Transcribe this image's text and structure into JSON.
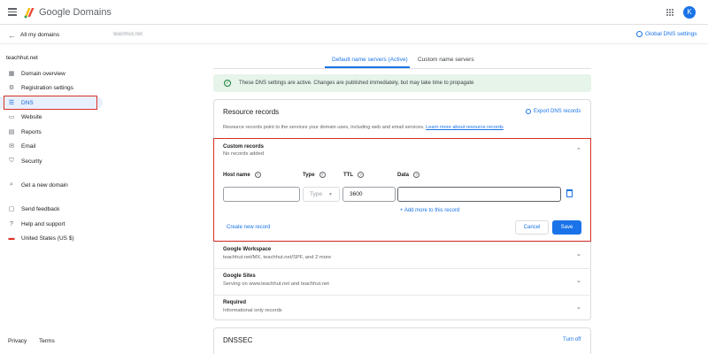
{
  "topbar": {
    "brand": "Google Domains",
    "avatar_letter": "K"
  },
  "subheader": {
    "back_label": "All my domains",
    "domain_crumb": "teachhut.net",
    "global_dns_label": "Global DNS settings"
  },
  "sidebar": {
    "site_name": "teachhut.net",
    "items": [
      {
        "label": "Domain overview",
        "icon": "domain-overview-icon",
        "glyph": "▦"
      },
      {
        "label": "Registration settings",
        "icon": "settings-icon",
        "glyph": "⚙"
      },
      {
        "label": "DNS",
        "icon": "dns-icon",
        "glyph": "☰"
      },
      {
        "label": "Website",
        "icon": "website-icon",
        "glyph": "▭"
      },
      {
        "label": "Reports",
        "icon": "reports-icon",
        "glyph": "▤"
      },
      {
        "label": "Email",
        "icon": "email-icon",
        "glyph": "✉"
      },
      {
        "label": "Security",
        "icon": "security-icon",
        "glyph": "⛉"
      },
      {
        "label": "Get a new domain",
        "icon": "search-icon",
        "glyph": "⌕"
      },
      {
        "label": "Send feedback",
        "icon": "feedback-icon",
        "glyph": "▢"
      },
      {
        "label": "Help and support",
        "icon": "help-icon",
        "glyph": "?"
      },
      {
        "label": "United States (US $)",
        "icon": "us-flag-icon",
        "glyph": "▬"
      }
    ],
    "footer": {
      "privacy": "Privacy",
      "terms": "Terms"
    }
  },
  "tabs": {
    "active": "Default name servers (Active)",
    "inactive": "Custom name servers"
  },
  "banner": {
    "text": "These DNS settings are active. Changes are published immediately, but may take time to propagate"
  },
  "resource_records": {
    "title": "Resource records",
    "export_label": "Export DNS records",
    "description": "Resource records point to the services your domain uses, including web and email services.",
    "learn_more": "Learn more about resource records",
    "custom": {
      "title": "Custom records",
      "subtitle": "No records added",
      "columns": {
        "host": "Host name",
        "type": "Type",
        "ttl": "TTL",
        "data": "Data"
      },
      "fields": {
        "host_value": "",
        "type_value": "Type",
        "ttl_value": "3600",
        "data_value": ""
      },
      "add_more": "+ Add more to this record",
      "create_new": "Create new record",
      "cancel": "Cancel",
      "save": "Save"
    },
    "sections": [
      {
        "title": "Google Workspace",
        "subtitle": "teachhut.net/MX, teachhut.net/SPF, and 2 more"
      },
      {
        "title": "Google Sites",
        "subtitle": "Serving on www.teachhut.net and teachhut.net"
      },
      {
        "title": "Required",
        "subtitle": "Informational only records"
      }
    ]
  },
  "dnssec": {
    "title": "DNSSEC",
    "action": "Turn off"
  },
  "colors": {
    "accent": "#1a73e8",
    "highlight": "#d93025",
    "banner_bg": "#e6f4ea"
  }
}
